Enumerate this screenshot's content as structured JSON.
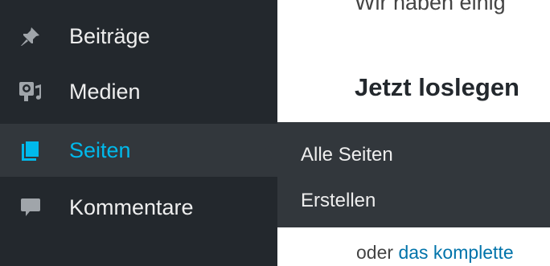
{
  "sidebar": {
    "items": [
      {
        "label": "Beiträge",
        "icon": "pin-icon"
      },
      {
        "label": "Medien",
        "icon": "media-icon"
      },
      {
        "label": "Seiten",
        "icon": "pages-icon",
        "active": true
      },
      {
        "label": "Kommentare",
        "icon": "comment-icon"
      }
    ],
    "submenu": [
      {
        "label": "Alle Seiten"
      },
      {
        "label": "Erstellen"
      }
    ]
  },
  "content": {
    "intro_text": "Wir haben einig",
    "section_title": "Jetzt loslegen",
    "bottom_text_prefix": "oder ",
    "bottom_link": "das komplette"
  },
  "colors": {
    "sidebar_bg": "#23282d",
    "submenu_bg": "#32373c",
    "active_text": "#00b9eb",
    "menu_text": "#eeeeee",
    "link": "#0073aa"
  }
}
